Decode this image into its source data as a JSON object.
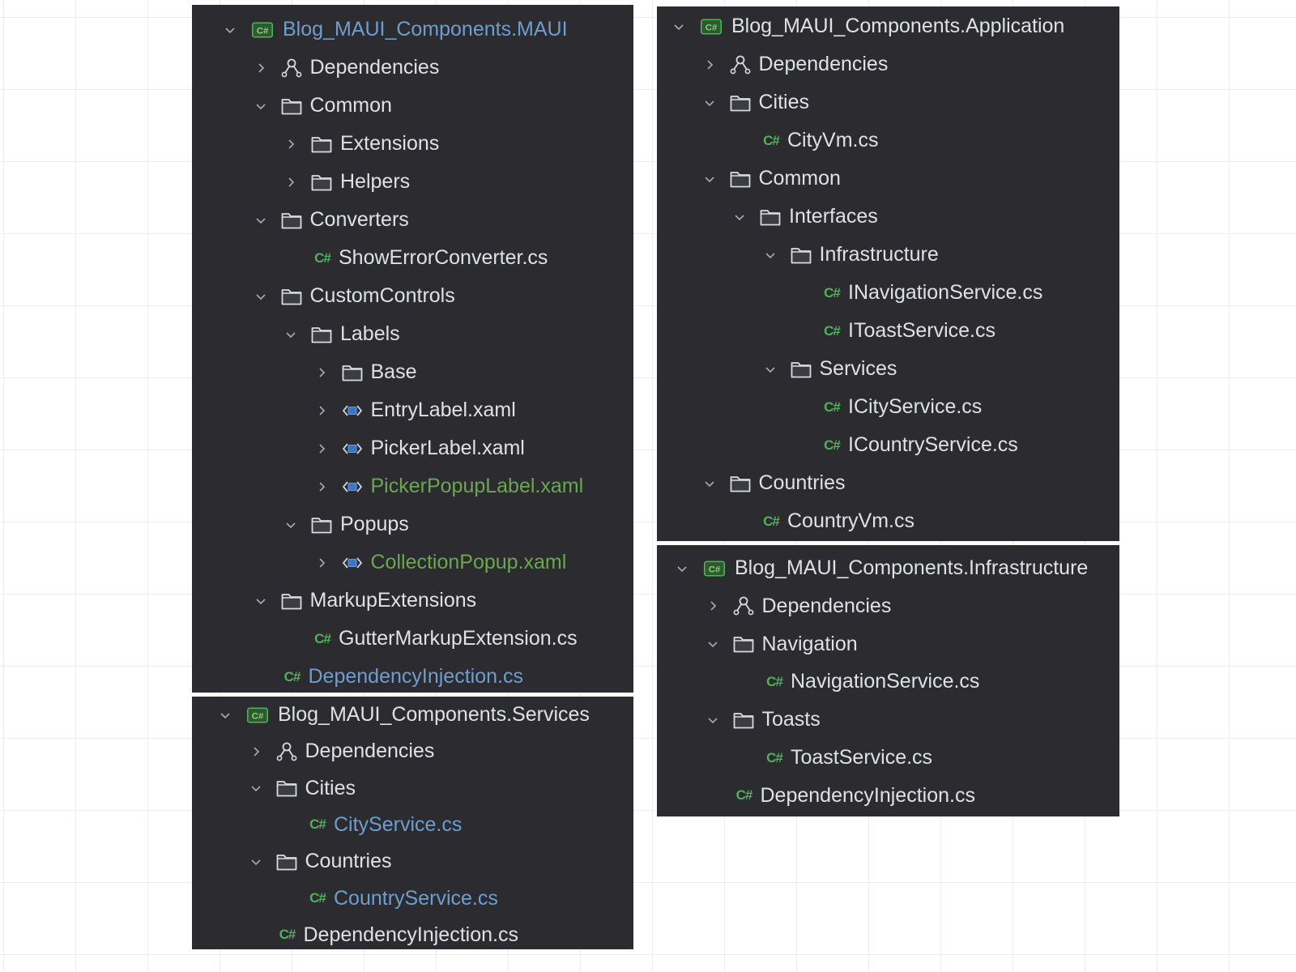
{
  "colors": {
    "panel_bg": "#2b2b30",
    "text_default": "#dfe1e5",
    "text_modified_blue": "#6e9ed0",
    "text_added_green": "#6aa84f",
    "csharp_icon_green": "#4fb35a",
    "xaml_icon_blue": "#3d74c9"
  },
  "panels": {
    "maui": {
      "items": [
        {
          "label": "Blog_MAUI_Components.MAUI",
          "icon": "csharp-project-icon",
          "chevron": "down",
          "color": "blue"
        },
        {
          "label": "Dependencies",
          "icon": "dependencies-icon",
          "chevron": "right",
          "color": "white"
        },
        {
          "label": "Common",
          "icon": "folder-icon",
          "chevron": "down",
          "color": "white"
        },
        {
          "label": "Extensions",
          "icon": "folder-icon",
          "chevron": "right",
          "color": "white"
        },
        {
          "label": "Helpers",
          "icon": "folder-icon",
          "chevron": "right",
          "color": "white"
        },
        {
          "label": "Converters",
          "icon": "folder-icon",
          "chevron": "down",
          "color": "white"
        },
        {
          "label": "ShowErrorConverter.cs",
          "icon": "csharp-file-icon",
          "chevron": "none",
          "color": "white"
        },
        {
          "label": "CustomControls",
          "icon": "folder-icon",
          "chevron": "down",
          "color": "white"
        },
        {
          "label": "Labels",
          "icon": "folder-icon",
          "chevron": "down",
          "color": "white"
        },
        {
          "label": "Base",
          "icon": "folder-icon",
          "chevron": "right",
          "color": "white"
        },
        {
          "label": "EntryLabel.xaml",
          "icon": "xaml-file-icon",
          "chevron": "right",
          "color": "white"
        },
        {
          "label": "PickerLabel.xaml",
          "icon": "xaml-file-icon",
          "chevron": "right",
          "color": "white"
        },
        {
          "label": "PickerPopupLabel.xaml",
          "icon": "xaml-file-icon",
          "chevron": "right",
          "color": "green"
        },
        {
          "label": "Popups",
          "icon": "folder-icon",
          "chevron": "down",
          "color": "white"
        },
        {
          "label": "CollectionPopup.xaml",
          "icon": "xaml-file-icon",
          "chevron": "right",
          "color": "green"
        },
        {
          "label": "MarkupExtensions",
          "icon": "folder-icon",
          "chevron": "down",
          "color": "white"
        },
        {
          "label": "GutterMarkupExtension.cs",
          "icon": "csharp-file-icon",
          "chevron": "none",
          "color": "white"
        },
        {
          "label": "DependencyInjection.cs",
          "icon": "csharp-file-icon",
          "chevron": "none",
          "color": "blue"
        }
      ]
    },
    "services": {
      "items": [
        {
          "label": "Blog_MAUI_Components.Services",
          "icon": "csharp-project-icon",
          "chevron": "down",
          "color": "white"
        },
        {
          "label": "Dependencies",
          "icon": "dependencies-icon",
          "chevron": "right",
          "color": "white"
        },
        {
          "label": "Cities",
          "icon": "folder-icon",
          "chevron": "down",
          "color": "white"
        },
        {
          "label": "CityService.cs",
          "icon": "csharp-file-icon",
          "chevron": "none",
          "color": "blue"
        },
        {
          "label": "Countries",
          "icon": "folder-icon",
          "chevron": "down",
          "color": "white"
        },
        {
          "label": "CountryService.cs",
          "icon": "csharp-file-icon",
          "chevron": "none",
          "color": "blue"
        },
        {
          "label": "DependencyInjection.cs",
          "icon": "csharp-file-icon",
          "chevron": "none",
          "color": "white"
        }
      ]
    },
    "application": {
      "items": [
        {
          "label": "Blog_MAUI_Components.Application",
          "icon": "csharp-project-icon",
          "chevron": "down",
          "color": "white"
        },
        {
          "label": "Dependencies",
          "icon": "dependencies-icon",
          "chevron": "right",
          "color": "white"
        },
        {
          "label": "Cities",
          "icon": "folder-icon",
          "chevron": "down",
          "color": "white"
        },
        {
          "label": "CityVm.cs",
          "icon": "csharp-file-icon",
          "chevron": "none",
          "color": "white"
        },
        {
          "label": "Common",
          "icon": "folder-icon",
          "chevron": "down",
          "color": "white"
        },
        {
          "label": "Interfaces",
          "icon": "folder-icon",
          "chevron": "down",
          "color": "white"
        },
        {
          "label": "Infrastructure",
          "icon": "folder-icon",
          "chevron": "down",
          "color": "white"
        },
        {
          "label": "INavigationService.cs",
          "icon": "csharp-file-icon",
          "chevron": "none",
          "color": "white"
        },
        {
          "label": "IToastService.cs",
          "icon": "csharp-file-icon",
          "chevron": "none",
          "color": "white"
        },
        {
          "label": "Services",
          "icon": "folder-icon",
          "chevron": "down",
          "color": "white"
        },
        {
          "label": "ICityService.cs",
          "icon": "csharp-file-icon",
          "chevron": "none",
          "color": "white"
        },
        {
          "label": "ICountryService.cs",
          "icon": "csharp-file-icon",
          "chevron": "none",
          "color": "white"
        },
        {
          "label": "Countries",
          "icon": "folder-icon",
          "chevron": "down",
          "color": "white"
        },
        {
          "label": "CountryVm.cs",
          "icon": "csharp-file-icon",
          "chevron": "none",
          "color": "white"
        }
      ]
    },
    "infrastructure": {
      "items": [
        {
          "label": "Blog_MAUI_Components.Infrastructure",
          "icon": "csharp-project-icon",
          "chevron": "down",
          "color": "white"
        },
        {
          "label": "Dependencies",
          "icon": "dependencies-icon",
          "chevron": "right",
          "color": "white"
        },
        {
          "label": "Navigation",
          "icon": "folder-icon",
          "chevron": "down",
          "color": "white"
        },
        {
          "label": "NavigationService.cs",
          "icon": "csharp-file-icon",
          "chevron": "none",
          "color": "white"
        },
        {
          "label": "Toasts",
          "icon": "folder-icon",
          "chevron": "down",
          "color": "white"
        },
        {
          "label": "ToastService.cs",
          "icon": "csharp-file-icon",
          "chevron": "none",
          "color": "white"
        },
        {
          "label": "DependencyInjection.cs",
          "icon": "csharp-file-icon",
          "chevron": "none",
          "color": "white"
        }
      ]
    }
  }
}
